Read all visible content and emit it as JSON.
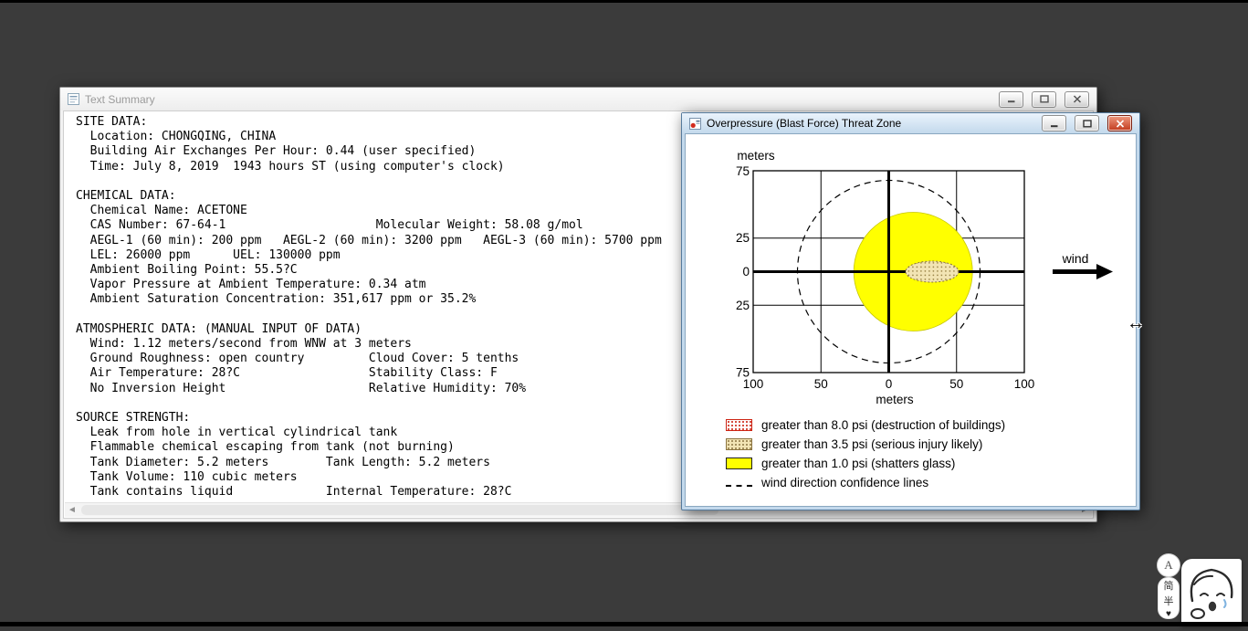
{
  "desktop": {
    "bg_color": "#3b3b3b"
  },
  "cursor": {
    "glyph": "↔"
  },
  "text_summary": {
    "title": "Text Summary",
    "content": "SITE DATA:\n  Location: CHONGQING, CHINA\n  Building Air Exchanges Per Hour: 0.44 (user specified)\n  Time: July 8, 2019  1943 hours ST (using computer's clock)\n\nCHEMICAL DATA:\n  Chemical Name: ACETONE\n  CAS Number: 67-64-1                     Molecular Weight: 58.08 g/mol\n  AEGL-1 (60 min): 200 ppm   AEGL-2 (60 min): 3200 ppm   AEGL-3 (60 min): 5700 ppm\n  LEL: 26000 ppm      UEL: 130000 ppm\n  Ambient Boiling Point: 55.5?C\n  Vapor Pressure at Ambient Temperature: 0.34 atm\n  Ambient Saturation Concentration: 351,617 ppm or 35.2%\n\nATMOSPHERIC DATA: (MANUAL INPUT OF DATA)\n  Wind: 1.12 meters/second from WNW at 3 meters\n  Ground Roughness: open country         Cloud Cover: 5 tenths\n  Air Temperature: 28?C                  Stability Class: F\n  No Inversion Height                    Relative Humidity: 70%\n\nSOURCE STRENGTH:\n  Leak from hole in vertical cylindrical tank\n  Flammable chemical escaping from tank (not burning)\n  Tank Diameter: 5.2 meters        Tank Length: 5.2 meters\n  Tank Volume: 110 cubic meters\n  Tank contains liquid             Internal Temperature: 28?C"
  },
  "overpressure": {
    "title": "Overpressure (Blast Force) Threat Zone",
    "y_axis_label": "meters",
    "x_axis_label": "meters",
    "y_ticks": [
      "75",
      "25",
      "0",
      "25",
      "75"
    ],
    "x_ticks": [
      "100",
      "50",
      "0",
      "50",
      "100"
    ],
    "wind_label": "wind",
    "legend": [
      {
        "swatch": "red-dotted",
        "label": "greater than 8.0 psi (destruction of buildings)"
      },
      {
        "swatch": "tan-dotted",
        "label": "greater than 3.5 psi (serious injury likely)"
      },
      {
        "swatch": "yellow",
        "label": "greater than 1.0 psi (shatters glass)"
      },
      {
        "swatch": "dashed-line",
        "label": "wind direction confidence lines"
      }
    ],
    "colors": {
      "zone_1psi": "#ffff00",
      "zone_35psi_fill": "#f2e4b4",
      "zone_8psi_dots": "#cc2211"
    },
    "chart_data": {
      "type": "threat_zone_map",
      "x_axis": {
        "label": "meters",
        "tick_positions_m": [
          -100,
          -50,
          0,
          50,
          100
        ],
        "tick_labels": [
          "100",
          "50",
          "0",
          "50",
          "100"
        ]
      },
      "y_axis": {
        "label": "meters",
        "tick_positions_m": [
          75,
          25,
          0,
          -25,
          -75
        ],
        "tick_labels": [
          "75",
          "25",
          "0",
          "25",
          "75"
        ]
      },
      "wind_arrow_direction": "toward +x",
      "zones": [
        {
          "threshold": "greater than 1.0 psi",
          "effect": "shatters glass",
          "shape": "circle",
          "center_m": [
            18,
            0
          ],
          "radius_m": 44,
          "fill": "#ffff00"
        },
        {
          "threshold": "greater than 3.5 psi",
          "effect": "serious injury likely",
          "shape": "ellipse",
          "center_m": [
            32,
            0
          ],
          "rx_m": 20,
          "ry_m": 8,
          "fill": "#f2e4b4"
        },
        {
          "threshold": "greater than 8.0 psi",
          "effect": "destruction of buildings",
          "shape": "not visible on plot"
        },
        {
          "name": "wind direction confidence lines",
          "shape": "dashed_circle",
          "center_m": [
            0,
            0
          ],
          "radius_m": 67
        }
      ]
    }
  },
  "widget": {
    "badge": "A",
    "items": [
      "简",
      "半"
    ],
    "heart": "♥"
  }
}
